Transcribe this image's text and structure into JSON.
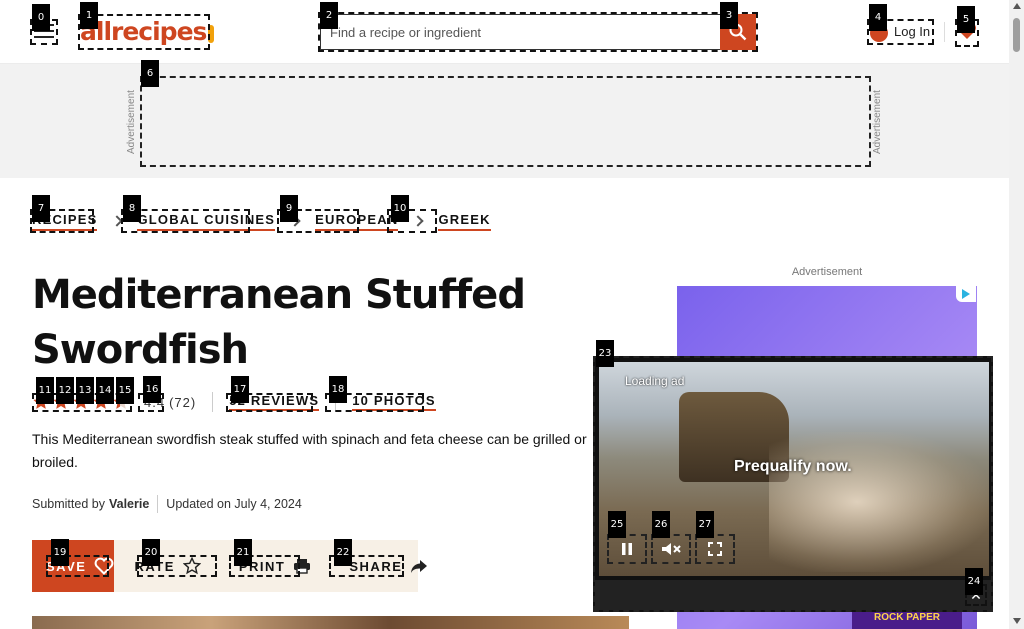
{
  "header": {
    "logo": "allrecipes",
    "search_placeholder": "Find a recipe or ingredient",
    "login_label": "Log In"
  },
  "ad_top": {
    "label": "Advertisement"
  },
  "breadcrumbs": [
    "RECIPES",
    "GLOBAL CUISINES",
    "EUROPEAN",
    "GREEK"
  ],
  "recipe": {
    "title": "Mediterranean Stuffed Swordfish",
    "rating_value": 4.4,
    "rating_display": "4.4",
    "rating_count": "(72)",
    "reviews_label": "52 REVIEWS",
    "photos_label": "10 PHOTOS",
    "description": "This Mediterranean swordfish steak stuffed with spinach and feta cheese can be grilled or broiled.",
    "submitted_prefix": "Submitted by",
    "author": "Valerie",
    "updated": "Updated on July 4, 2024"
  },
  "actions": {
    "save": "SAVE",
    "rate": "RATE",
    "print": "PRINT",
    "share": "SHARE"
  },
  "right_ad": {
    "label": "Advertisement",
    "game_text": "ROCK PAPER SCISSORS"
  },
  "video": {
    "loading_text": "Loading ad",
    "promo_text": "Prequalify now."
  },
  "markers": [
    "0",
    "1",
    "2",
    "3",
    "4",
    "5",
    "6",
    "7",
    "8",
    "9",
    "10",
    "11",
    "12",
    "13",
    "14",
    "15",
    "16",
    "17",
    "18",
    "19",
    "20",
    "21",
    "22",
    "23",
    "24",
    "25",
    "26",
    "27"
  ],
  "colors": {
    "brand": "#ce4620",
    "accent": "#f1a10b",
    "action_bg": "#f7f0e6"
  },
  "icons": {
    "menu": "hamburger-icon",
    "search": "search-icon",
    "user": "user-icon",
    "favorite": "heart-icon",
    "star": "star-icon",
    "print": "printer-icon",
    "share": "share-arrow-icon",
    "pause": "pause-icon",
    "mute": "muted-speaker-icon",
    "fullscreen": "fullscreen-icon",
    "close": "close-icon"
  }
}
